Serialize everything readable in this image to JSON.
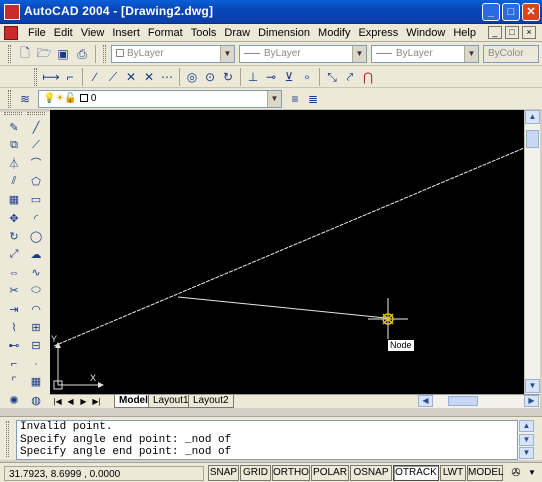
{
  "window": {
    "title": "AutoCAD 2004 - [Drawing2.dwg]",
    "minimize": "_",
    "maximize": "□",
    "close": "✕"
  },
  "menu": {
    "items": [
      "File",
      "Edit",
      "View",
      "Insert",
      "Format",
      "Tools",
      "Draw",
      "Dimension",
      "Modify",
      "Express",
      "Window",
      "Help"
    ],
    "doc_controls": [
      "_",
      "□",
      "×"
    ]
  },
  "properties_toolbar": {
    "color_combo": "ByLayer",
    "linetype_combo": "ByLayer",
    "lineweight_combo": "ByLayer",
    "plotstyle_combo": "ByColor"
  },
  "layers_toolbar": {
    "layer_value": "0"
  },
  "tooltip": {
    "snap_label": "Node"
  },
  "layout_tabs": [
    "Model",
    "Layout1",
    "Layout2"
  ],
  "command_line": {
    "lines": [
      "Invalid point.",
      "Specify angle end point: _nod of",
      "Specify angle end point: _nod of"
    ]
  },
  "status_bar": {
    "coordinates": "31.7923, 8.6999 , 0.0000",
    "buttons": [
      {
        "label": "SNAP",
        "on": false
      },
      {
        "label": "GRID",
        "on": false
      },
      {
        "label": "ORTHO",
        "on": false
      },
      {
        "label": "POLAR",
        "on": false
      },
      {
        "label": "OSNAP",
        "on": false
      },
      {
        "label": "OTRACK",
        "on": true
      },
      {
        "label": "LWT",
        "on": false
      },
      {
        "label": "MODEL",
        "on": false
      }
    ]
  },
  "ucs": {
    "x_label": "X",
    "y_label": "Y"
  },
  "icons": {
    "toolbar_row1": [
      "new-icon",
      "open-icon",
      "save-icon",
      "print-icon",
      "layer-properties-icon",
      "layer-icon"
    ],
    "toolbar_row2": [
      "dimension-linear-icon",
      "dimension-aligned-icon",
      "dimension-radius-icon",
      "dimension-diameter-icon",
      "dimension-angular-icon",
      "quick-leader-icon",
      "center-mark-icon",
      "tolerance-icon",
      "dimension-edit-icon",
      "dimension-update-icon",
      "dimension-style-icon"
    ],
    "draw_toolbar": [
      "line-icon",
      "construction-line-icon",
      "polyline-icon",
      "polygon-icon",
      "rectangle-icon",
      "arc-icon",
      "circle-icon",
      "revision-cloud-icon",
      "spline-icon",
      "ellipse-icon",
      "ellipse-arc-icon",
      "insert-block-icon",
      "make-block-icon",
      "point-icon",
      "hatch-icon",
      "region-icon",
      "table-icon",
      "multiline-text-icon"
    ],
    "modify_toolbar": [
      "erase-icon",
      "copy-icon",
      "mirror-icon",
      "offset-icon",
      "array-icon",
      "move-icon",
      "rotate-icon",
      "scale-icon",
      "stretch-icon",
      "trim-icon",
      "extend-icon",
      "break-icon",
      "join-icon",
      "chamfer-icon",
      "fillet-icon",
      "explode-icon"
    ]
  },
  "colors": {
    "drawing_background": "#000000",
    "line": "#e8e8e8",
    "cursor": "#f0f0f0",
    "osnap_marker": "#e0c000",
    "title_bar": "#0a5fd8"
  }
}
